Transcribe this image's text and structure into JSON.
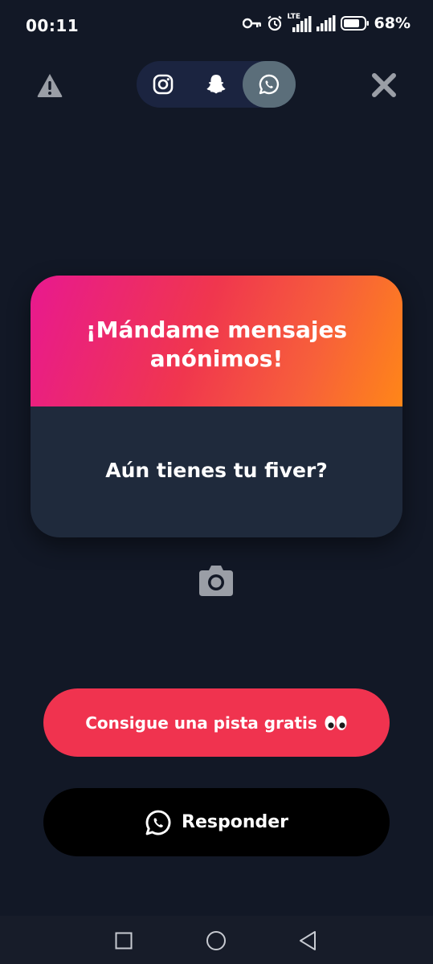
{
  "status_bar": {
    "time": "00:11",
    "network_label": "LTE",
    "battery": "68%"
  },
  "top_bar": {
    "share_options": [
      "instagram",
      "snapchat",
      "whatsapp"
    ],
    "active_option": "whatsapp"
  },
  "card": {
    "title": "¡Mándame mensajes anónimos!",
    "question": "Aún tienes tu fiver?"
  },
  "actions": {
    "hint_label": "Consigue una pista gratis",
    "hint_icon": "eyes-emoji",
    "reply_label": "Responder",
    "reply_icon": "whatsapp-icon"
  },
  "colors": {
    "background": "#121826",
    "gradient_start": "#e8198f",
    "gradient_end": "#ff8618",
    "card_body": "#1f2a3c",
    "hint_button": "#f0334f",
    "reply_button": "#000000",
    "active_toggle": "#5b6e7a"
  }
}
